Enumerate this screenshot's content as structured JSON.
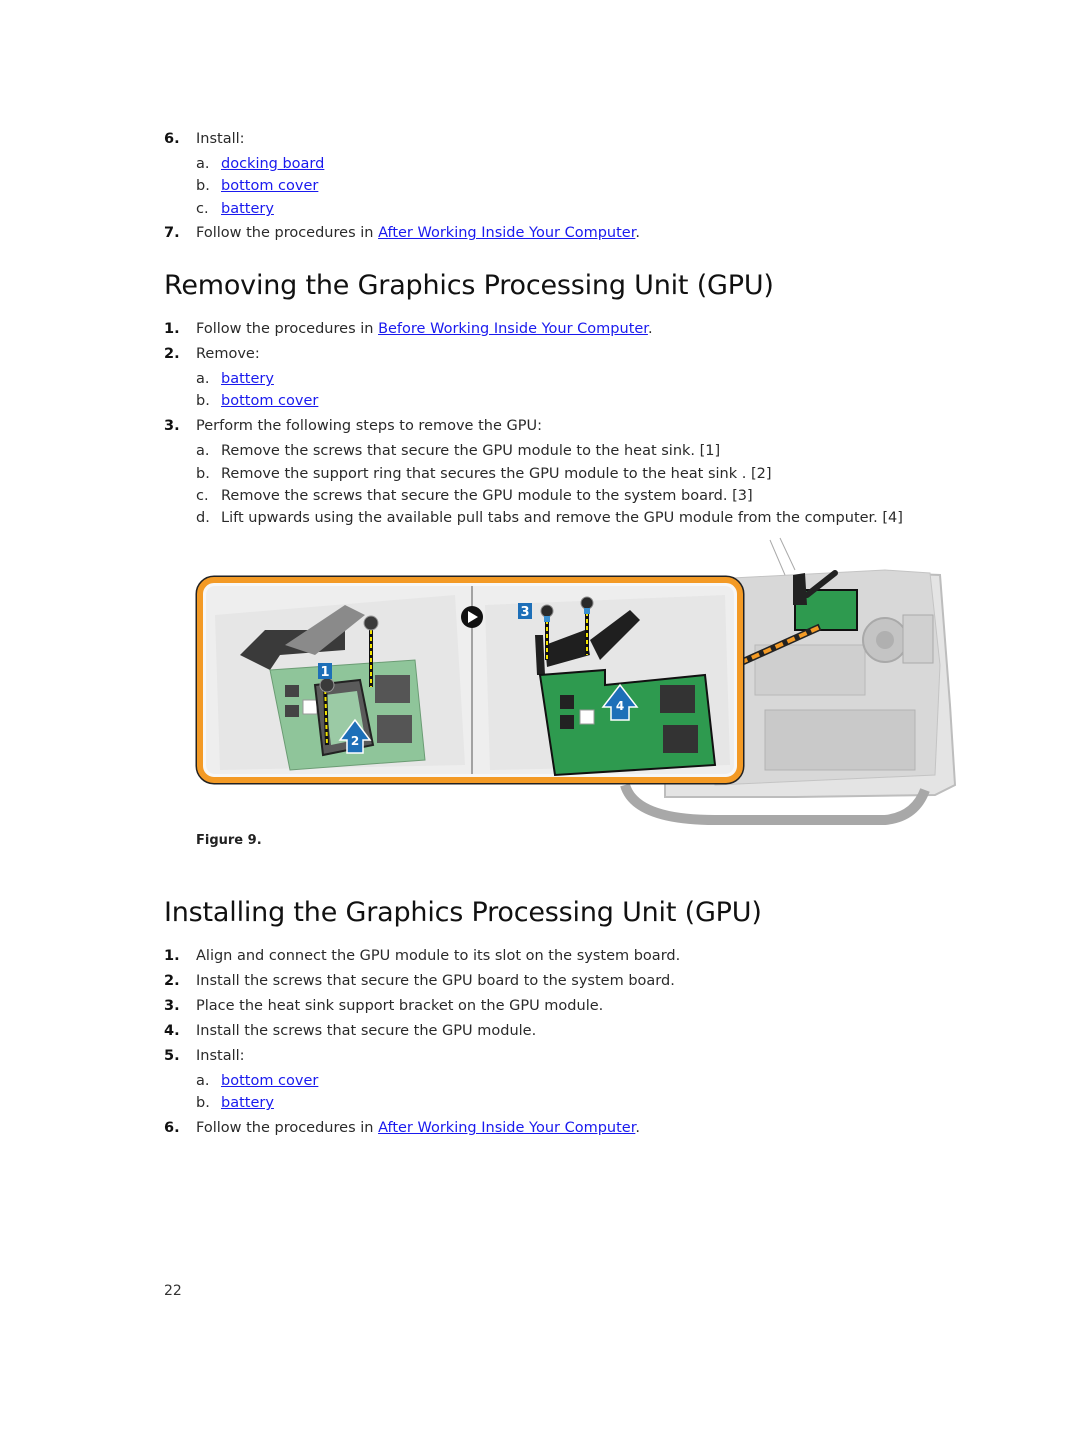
{
  "top_list": {
    "step6": {
      "num": "6.",
      "label": "Install:",
      "items": [
        {
          "letter": "a.",
          "link": "docking board"
        },
        {
          "letter": "b.",
          "link": "bottom cover"
        },
        {
          "letter": "c.",
          "link": "battery"
        }
      ]
    },
    "step7": {
      "num": "7.",
      "prefix": "Follow the procedures in ",
      "link": "After Working Inside Your Computer",
      "suffix": "."
    }
  },
  "removing": {
    "title": "Removing the Graphics Processing Unit (GPU)",
    "steps": [
      {
        "num": "1.",
        "prefix": "Follow the procedures in ",
        "link": "Before Working Inside Your Computer",
        "suffix": "."
      },
      {
        "num": "2.",
        "label": "Remove:",
        "items": [
          {
            "letter": "a.",
            "link": "battery"
          },
          {
            "letter": "b.",
            "link": "bottom cover"
          }
        ]
      },
      {
        "num": "3.",
        "label": "Perform the following steps to remove the GPU:",
        "items": [
          {
            "letter": "a.",
            "text": "Remove the screws that secure the GPU module to the heat sink. [1]"
          },
          {
            "letter": "b.",
            "text": "Remove the support ring that secures the GPU module to the heat sink . [2]"
          },
          {
            "letter": "c.",
            "text": "Remove the screws that secure the GPU module to the system board. [3]"
          },
          {
            "letter": "d.",
            "text": "Lift upwards using the available pull tabs and remove the GPU module from the computer. [4]"
          }
        ]
      }
    ],
    "figure": {
      "caption": "Figure 9.",
      "callouts": [
        "1",
        "2",
        "3",
        "4"
      ],
      "colors": {
        "frame": "#f39a25",
        "callout": "#1d6fb8",
        "board": "#2e9a4f"
      }
    }
  },
  "installing": {
    "title": "Installing the Graphics Processing Unit (GPU)",
    "steps": [
      {
        "num": "1.",
        "text": "Align and connect the GPU module to its slot on the system board."
      },
      {
        "num": "2.",
        "text": "Install the screws that secure the GPU board to the system board."
      },
      {
        "num": "3.",
        "text": "Place the heat sink support bracket on the GPU module."
      },
      {
        "num": "4.",
        "text": "Install the screws that secure the GPU module."
      },
      {
        "num": "5.",
        "label": "Install:",
        "items": [
          {
            "letter": "a.",
            "link": "bottom cover"
          },
          {
            "letter": "b.",
            "link": "battery"
          }
        ]
      },
      {
        "num": "6.",
        "prefix": "Follow the procedures in ",
        "link": "After Working Inside Your Computer",
        "suffix": "."
      }
    ]
  },
  "footer": {
    "page_number": "22"
  }
}
